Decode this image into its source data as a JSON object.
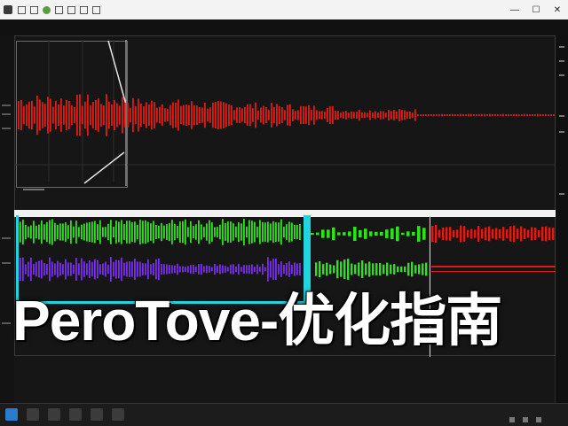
{
  "window": {
    "title": "",
    "minimize_icon": "minimize-icon",
    "maximize_icon": "maximize-icon",
    "close_icon": "close-icon"
  },
  "overlay": {
    "text": "PeroTove-优化指南"
  },
  "colors": {
    "track_red": "#e01b14",
    "track_green": "#2fe01e",
    "track_purple": "#7a2cf0",
    "cyan_highlight": "#20d5e0",
    "background": "#161616"
  },
  "taskbar": {
    "start_icon": "windows-start-icon",
    "tray_icons": [
      "network-icon",
      "volume-icon",
      "clock-icon"
    ]
  }
}
